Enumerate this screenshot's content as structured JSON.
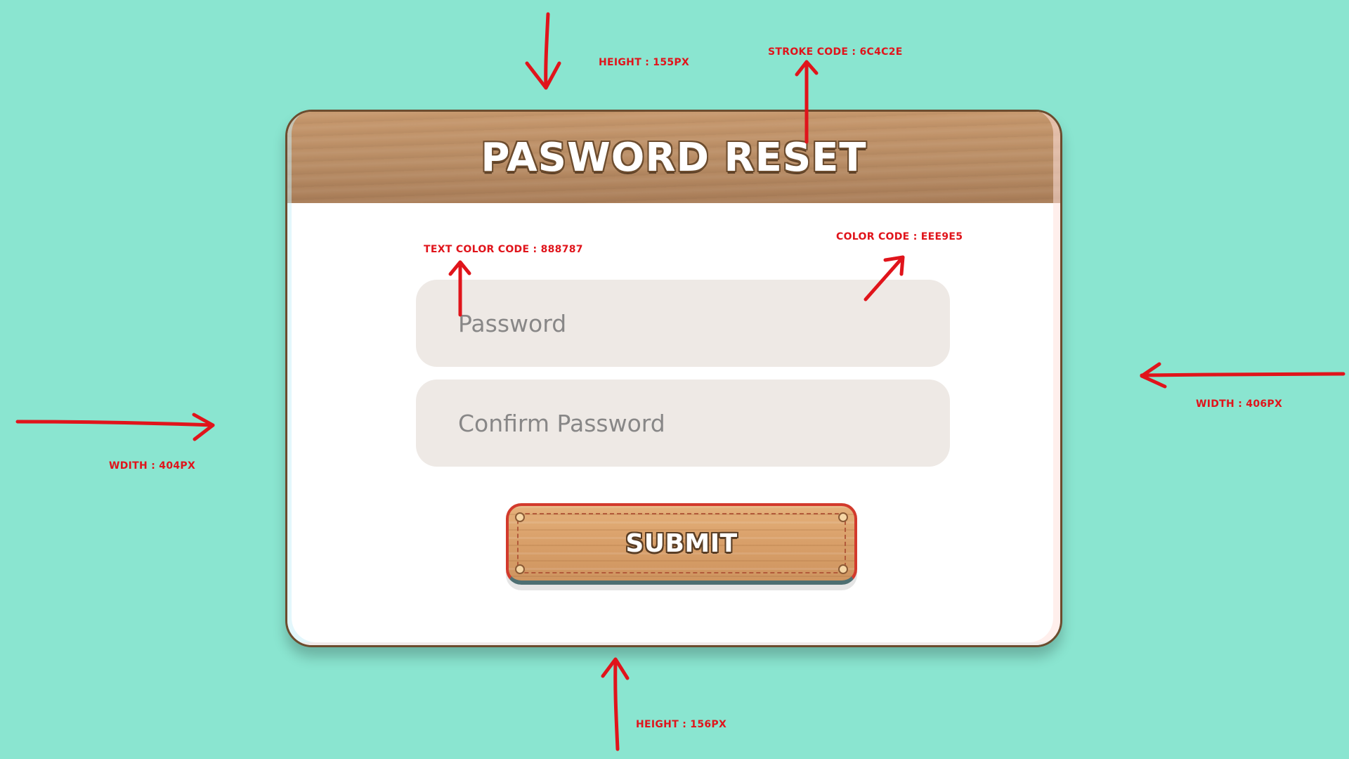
{
  "page": {
    "background_color": "#8AE5D0"
  },
  "card": {
    "title": "PASWORD RESET",
    "header_color": "#B88C64",
    "stroke_color": "#6C4C2E",
    "password_field": {
      "placeholder": "Password",
      "value": ""
    },
    "confirm_field": {
      "placeholder": "Confirm Password",
      "value": ""
    },
    "field_color": "#EEE9E5",
    "field_text_color": "#888787",
    "submit_label": "SUBMIT"
  },
  "annotations": {
    "height_top": "HEIGHT : 155PX",
    "stroke_code": "STROKE CODE : 6C4C2E",
    "text_color_code": "TEXT COLOR CODE :  888787",
    "color_code": "COLOR CODE :  EEE9E5",
    "width_right": "WIDTH : 406PX",
    "width_left": "WDITH : 404PX",
    "height_bottom": "HEIGHT : 156PX",
    "color": "#E0141B"
  }
}
